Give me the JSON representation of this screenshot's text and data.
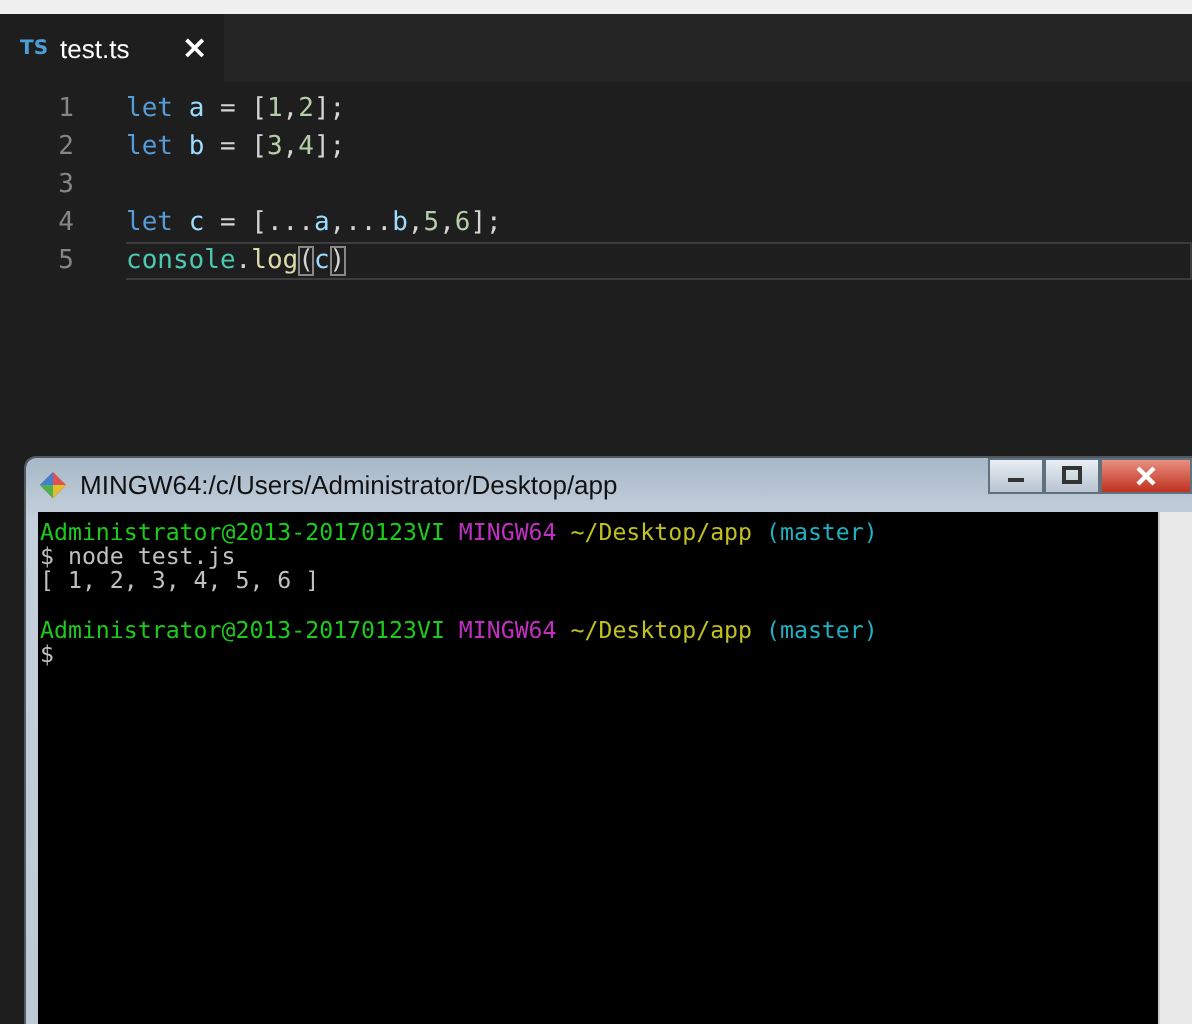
{
  "editor": {
    "tab": {
      "icon_text": "TS",
      "label": "test.ts",
      "close": "×",
      "selected": true
    },
    "lines": [
      {
        "number": "1",
        "current": false,
        "tokens": [
          {
            "kind": "keyword",
            "text": "let"
          },
          {
            "kind": "variable",
            "text": "a",
            "space_before": true
          },
          {
            "kind": "plain",
            "text": "=",
            "space_before": true
          },
          {
            "kind": "bracket",
            "text": "[",
            "space_before": true
          },
          {
            "kind": "number",
            "text": "1"
          },
          {
            "kind": "plain",
            "text": ","
          },
          {
            "kind": "number",
            "text": "2"
          },
          {
            "kind": "bracket",
            "text": "]"
          },
          {
            "kind": "plain",
            "text": ";"
          }
        ]
      },
      {
        "number": "2",
        "current": false,
        "tokens": [
          {
            "kind": "keyword",
            "text": "let"
          },
          {
            "kind": "variable",
            "text": "b",
            "space_before": true
          },
          {
            "kind": "plain",
            "text": "=",
            "space_before": true
          },
          {
            "kind": "bracket",
            "text": "[",
            "space_before": true
          },
          {
            "kind": "number",
            "text": "3"
          },
          {
            "kind": "plain",
            "text": ","
          },
          {
            "kind": "number",
            "text": "4"
          },
          {
            "kind": "bracket",
            "text": "]"
          },
          {
            "kind": "plain",
            "text": ";"
          }
        ]
      },
      {
        "number": "3",
        "current": false
      },
      {
        "number": "4",
        "current": false,
        "tokens": [
          {
            "kind": "keyword",
            "text": "let"
          },
          {
            "kind": "variable",
            "text": "c",
            "space_before": true
          },
          {
            "kind": "plain",
            "text": "=",
            "space_before": true
          },
          {
            "kind": "bracket",
            "text": "[",
            "space_before": true
          },
          {
            "kind": "plain",
            "text": "..."
          },
          {
            "kind": "variable",
            "text": "a"
          },
          {
            "kind": "plain",
            "text": ",..."
          },
          {
            "kind": "variable",
            "text": "b"
          },
          {
            "kind": "plain",
            "text": ","
          },
          {
            "kind": "number",
            "text": "5"
          },
          {
            "kind": "plain",
            "text": ","
          },
          {
            "kind": "number",
            "text": "6"
          },
          {
            "kind": "bracket",
            "text": "]"
          },
          {
            "kind": "plain",
            "text": ";"
          }
        ]
      },
      {
        "number": "5",
        "current": true,
        "tokens": [
          {
            "kind": "type",
            "text": "console"
          },
          {
            "kind": "plain",
            "text": "."
          },
          {
            "kind": "function",
            "text": "log"
          },
          {
            "kind": "match",
            "text": "("
          },
          {
            "kind": "variable",
            "text": "c"
          },
          {
            "kind": "match",
            "text": ")"
          }
        ]
      }
    ]
  },
  "terminal": {
    "title": "MINGW64:/c/Users/Administrator/Desktop/app",
    "lines": [
      {
        "segments": [
          {
            "kind": "user",
            "text": "Administrator@2013-20170123VI"
          },
          {
            "kind": "system",
            "text": "MINGW64",
            "space_before": true
          },
          {
            "kind": "path",
            "text": "~/Desktop/app",
            "space_before": true
          },
          {
            "kind": "branch",
            "text": "(master)",
            "space_before": true
          }
        ]
      },
      {
        "segments": [
          {
            "kind": "plain",
            "text": "$ node test.js"
          }
        ]
      },
      {
        "segments": [
          {
            "kind": "plain",
            "text": "[ 1, 2, 3, 4, 5, 6 ]"
          }
        ]
      },
      {
        "blank_before": true,
        "segments": [
          {
            "kind": "user",
            "text": "Administrator@2013-20170123VI"
          },
          {
            "kind": "system",
            "text": "MINGW64",
            "space_before": true
          },
          {
            "kind": "path",
            "text": "~/Desktop/app",
            "space_before": true
          },
          {
            "kind": "branch",
            "text": "(master)",
            "space_before": true
          }
        ]
      },
      {
        "segments": [
          {
            "kind": "plain",
            "text": "$"
          }
        ]
      }
    ]
  }
}
